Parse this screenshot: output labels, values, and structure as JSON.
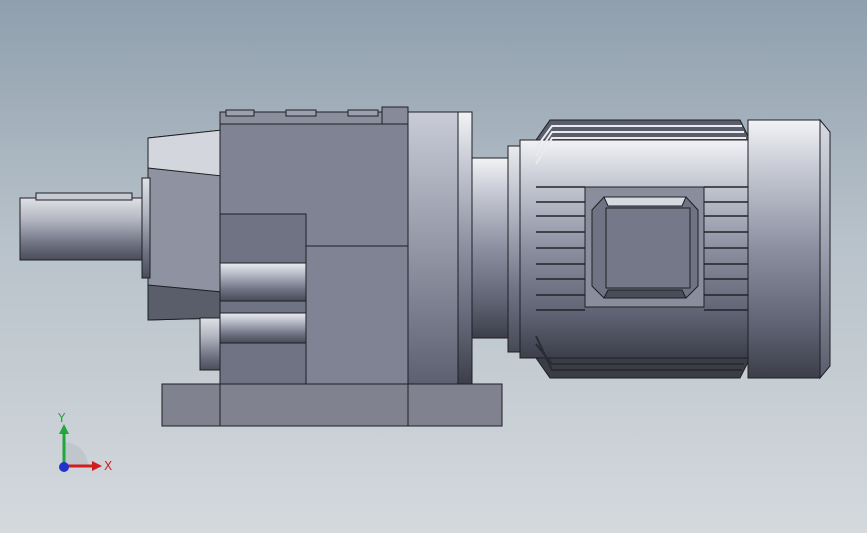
{
  "viewport": {
    "background_top": "#8f9fad",
    "background_bottom": "#d4d9dd"
  },
  "model": {
    "part": "gear-motor",
    "body_color": "#7e8291",
    "edge_color": "#1e1f24"
  },
  "triad": {
    "x_label": "X",
    "y_label": "Y",
    "x_color": "#d11f1f",
    "y_color": "#21a63a",
    "z_color": "#2233cc"
  }
}
